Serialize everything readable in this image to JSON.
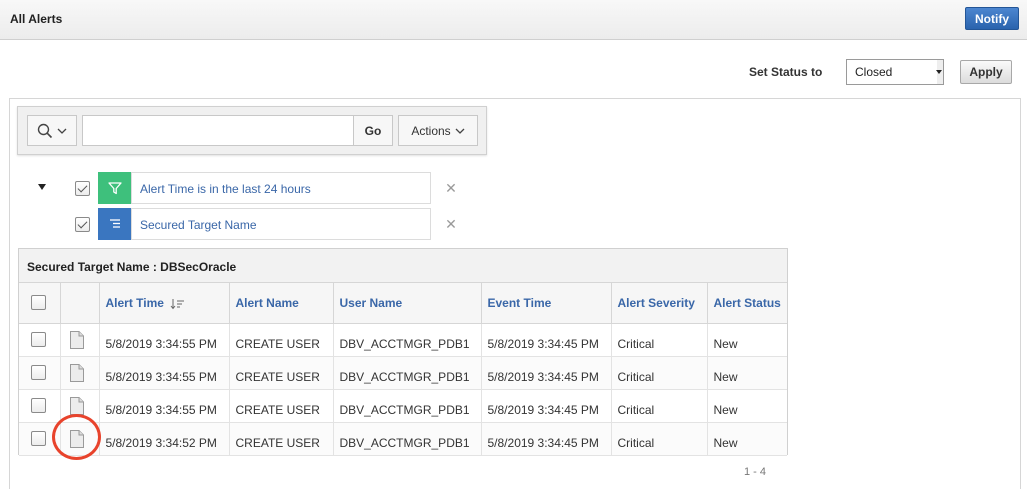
{
  "header": {
    "title": "All Alerts",
    "notify_label": "Notify"
  },
  "status_bar": {
    "label": "Set Status to",
    "selected": "Closed",
    "apply_label": "Apply"
  },
  "toolbar": {
    "search_value": "",
    "go_label": "Go",
    "actions_label": "Actions"
  },
  "filters": [
    {
      "label": "Alert Time is in the last 24 hours",
      "kind": "filter",
      "icon": "funnel-icon",
      "color": "#3ec07c",
      "checked": true
    },
    {
      "label": "Secured Target Name",
      "kind": "control-break",
      "icon": "control-break-icon",
      "color": "#3a76c0",
      "checked": true
    }
  ],
  "grid": {
    "group_header": "Secured Target Name : DBSecOracle",
    "columns": [
      "Alert Time",
      "Alert Name",
      "User Name",
      "Event Time",
      "Alert Severity",
      "Alert Status"
    ],
    "rows": [
      {
        "alert_time": "5/8/2019 3:34:55 PM",
        "alert_name": "CREATE USER",
        "user_name": "DBV_ACCTMGR_PDB1",
        "event_time": "5/8/2019 3:34:45 PM",
        "severity": "Critical",
        "status": "New"
      },
      {
        "alert_time": "5/8/2019 3:34:55 PM",
        "alert_name": "CREATE USER",
        "user_name": "DBV_ACCTMGR_PDB1",
        "event_time": "5/8/2019 3:34:45 PM",
        "severity": "Critical",
        "status": "New"
      },
      {
        "alert_time": "5/8/2019 3:34:55 PM",
        "alert_name": "CREATE USER",
        "user_name": "DBV_ACCTMGR_PDB1",
        "event_time": "5/8/2019 3:34:45 PM",
        "severity": "Critical",
        "status": "New"
      },
      {
        "alert_time": "5/8/2019 3:34:52 PM",
        "alert_name": "CREATE USER",
        "user_name": "DBV_ACCTMGR_PDB1",
        "event_time": "5/8/2019 3:34:45 PM",
        "severity": "Critical",
        "status": "New"
      }
    ],
    "pagination": "1 - 4"
  },
  "colors": {
    "primary_button": "#2a63ad",
    "link_text": "#3a67a8",
    "annotation_ring": "#e8432c"
  }
}
